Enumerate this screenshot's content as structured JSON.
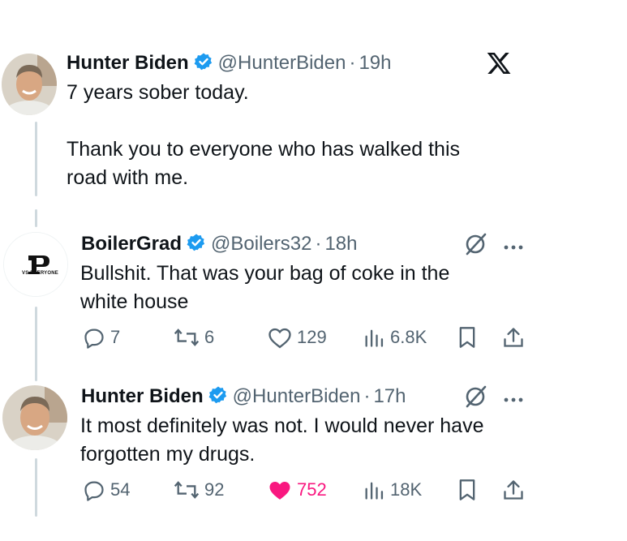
{
  "tweets": [
    {
      "name": "Hunter Biden",
      "handle": "@HunterBiden",
      "separator": "·",
      "time": "19h",
      "lines": [
        "7 years sober today.",
        "",
        "Thank you to everyone who has walked this",
        "road with me."
      ]
    },
    {
      "name": "BoilerGrad",
      "handle": "@Boilers32",
      "separator": "·",
      "time": "18h",
      "avatar_text": "VS EVERYONE",
      "lines": [
        "Bullshit. That was your bag of coke in the",
        "white house"
      ],
      "actions": {
        "replies": "7",
        "reposts": "6",
        "likes": "129",
        "views": "6.8K"
      }
    },
    {
      "name": "Hunter Biden",
      "handle": "@HunterBiden",
      "separator": "·",
      "time": "17h",
      "lines": [
        "It most definitely was not. I would never have",
        "forgotten my drugs."
      ],
      "actions": {
        "replies": "54",
        "reposts": "92",
        "likes": "752",
        "views": "18K"
      }
    }
  ],
  "colors": {
    "verified": "#1d9bf0",
    "like_active": "#f91880",
    "muted": "#536471",
    "thread": "#cfd9de"
  },
  "icons": [
    "x-logo-icon",
    "verified-badge-icon",
    "grok-icon",
    "more-icon",
    "reply-icon",
    "repost-icon",
    "like-icon",
    "views-icon",
    "bookmark-icon",
    "share-icon"
  ]
}
